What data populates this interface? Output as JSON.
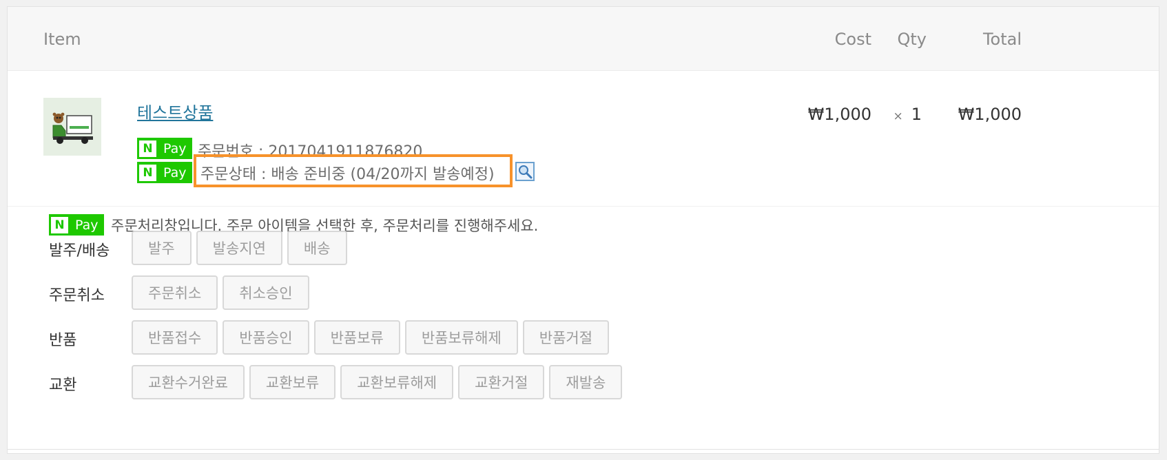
{
  "table": {
    "headers": {
      "item": "Item",
      "cost": "Cost",
      "qty": "Qty",
      "total": "Total"
    }
  },
  "item": {
    "name": "테스트상품",
    "thumbnail_icon": "delivery-truck-icon",
    "npay_n": "N",
    "npay_label": "Pay",
    "order_number": "주문번호 : 2017041911876820",
    "order_status": "주문상태 : 배송 준비중 (04/20까지 발송예정)",
    "cost": "₩1,000",
    "qty_symbol": "×",
    "qty": "1",
    "total": "₩1,000"
  },
  "processing": {
    "description": "주문처리창입니다. 주문 아이템을 선택한 후, 주문처리를 진행해주세요.",
    "groups": [
      {
        "label": "발주/배송",
        "buttons": [
          "발주",
          "발송지연",
          "배송"
        ]
      },
      {
        "label": "주문취소",
        "buttons": [
          "주문취소",
          "취소승인"
        ]
      },
      {
        "label": "반품",
        "buttons": [
          "반품접수",
          "반품승인",
          "반품보류",
          "반품보류해제",
          "반품거절"
        ]
      },
      {
        "label": "교환",
        "buttons": [
          "교환수거완료",
          "교환보류",
          "교환보류해제",
          "교환거절",
          "재발송"
        ]
      }
    ]
  },
  "colors": {
    "npay_green": "#1ec800",
    "highlight_orange": "#f7922b",
    "link_blue": "#21759b"
  }
}
